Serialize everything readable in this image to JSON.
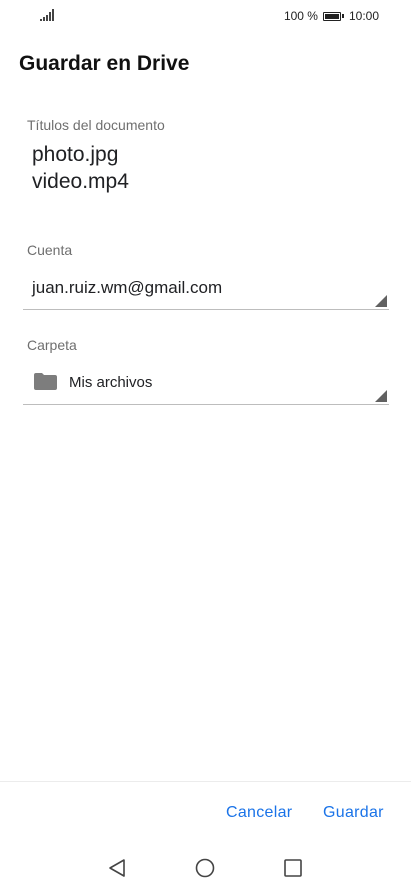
{
  "status_bar": {
    "battery_text": "100 %",
    "battery_level": 1.0,
    "time": "10:00",
    "signal_icon": "signal-icon"
  },
  "page": {
    "title": "Guardar en Drive"
  },
  "form": {
    "documents": {
      "label": "Títulos del documento",
      "files": [
        "photo.jpg",
        "video.mp4"
      ]
    },
    "account": {
      "label": "Cuenta",
      "value": "juan.ruiz.wm@gmail.com"
    },
    "folder": {
      "label": "Carpeta",
      "value": "Mis archivos",
      "icon": "folder-icon"
    }
  },
  "actions": {
    "cancel_label": "Cancelar",
    "save_label": "Guardar",
    "accent_color": "#1a73e8"
  },
  "nav_bar": {
    "back_icon": "back-triangle-icon",
    "home_icon": "home-circle-icon",
    "recents_icon": "recents-square-icon"
  }
}
